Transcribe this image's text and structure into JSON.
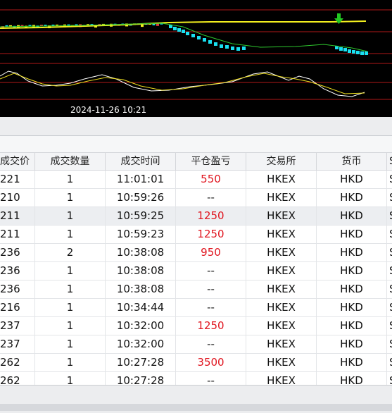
{
  "chart": {
    "timestamp_label": "2024-11-26 10:21",
    "colors": {
      "background": "#000000",
      "grid_red": "#b01818",
      "price_line": "#f2ee1e",
      "candle_cyan": "#19e0f0",
      "ma_green": "#2ec82e",
      "indicator_white": "#ffffff",
      "indicator_yellow": "#f0e020",
      "signal_arrow": "#22c822"
    },
    "signal_icon": "down-arrow-icon"
  },
  "table": {
    "columns": [
      "成交价",
      "成交数量",
      "成交时间",
      "平仓盈亏",
      "交易所",
      "货币",
      "S"
    ],
    "rows": [
      {
        "price": "221",
        "qty": "1",
        "time": "11:01:01",
        "pnl": "550",
        "exchange": "HKEX",
        "currency": "HKD",
        "extra": "S"
      },
      {
        "price": "210",
        "qty": "1",
        "time": "10:59:26",
        "pnl": "--",
        "exchange": "HKEX",
        "currency": "HKD",
        "extra": "S"
      },
      {
        "price": "211",
        "qty": "1",
        "time": "10:59:25",
        "pnl": "1250",
        "exchange": "HKEX",
        "currency": "HKD",
        "extra": "S"
      },
      {
        "price": "211",
        "qty": "1",
        "time": "10:59:23",
        "pnl": "1250",
        "exchange": "HKEX",
        "currency": "HKD",
        "extra": "S"
      },
      {
        "price": "236",
        "qty": "2",
        "time": "10:38:08",
        "pnl": "950",
        "exchange": "HKEX",
        "currency": "HKD",
        "extra": "S"
      },
      {
        "price": "236",
        "qty": "1",
        "time": "10:38:08",
        "pnl": "--",
        "exchange": "HKEX",
        "currency": "HKD",
        "extra": "S"
      },
      {
        "price": "236",
        "qty": "1",
        "time": "10:38:08",
        "pnl": "--",
        "exchange": "HKEX",
        "currency": "HKD",
        "extra": "S"
      },
      {
        "price": "216",
        "qty": "1",
        "time": "10:34:44",
        "pnl": "--",
        "exchange": "HKEX",
        "currency": "HKD",
        "extra": "S"
      },
      {
        "price": "237",
        "qty": "1",
        "time": "10:32:00",
        "pnl": "1250",
        "exchange": "HKEX",
        "currency": "HKD",
        "extra": "S"
      },
      {
        "price": "237",
        "qty": "1",
        "time": "10:32:00",
        "pnl": "--",
        "exchange": "HKEX",
        "currency": "HKD",
        "extra": "S"
      },
      {
        "price": "262",
        "qty": "1",
        "time": "10:27:28",
        "pnl": "3500",
        "exchange": "HKEX",
        "currency": "HKD",
        "extra": "S"
      },
      {
        "price": "262",
        "qty": "1",
        "time": "10:27:28",
        "pnl": "--",
        "exchange": "HKEX",
        "currency": "HKD",
        "extra": "S"
      }
    ],
    "selected_row": 2
  }
}
